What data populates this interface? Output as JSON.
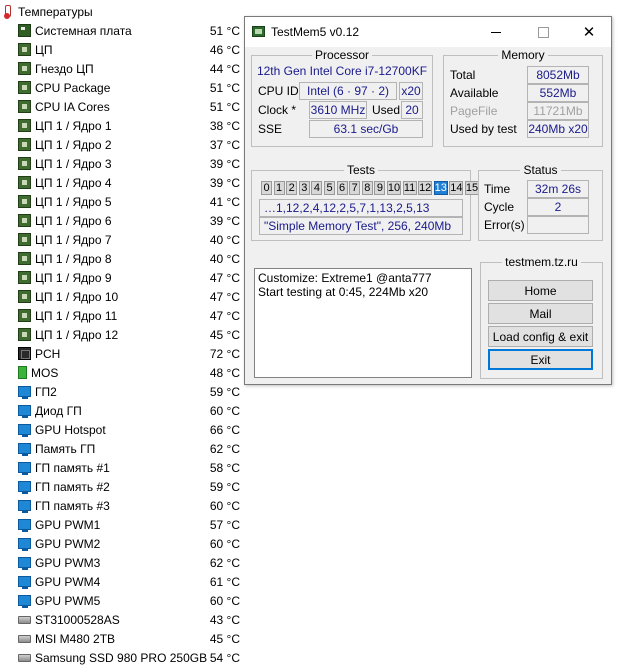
{
  "sensors": {
    "root_label": "Температуры",
    "items": [
      {
        "name": "Системная плата",
        "value": "51 °C",
        "icon": "motherboard-icon"
      },
      {
        "name": "ЦП",
        "value": "46 °C",
        "icon": "cpu-icon"
      },
      {
        "name": "Гнездо ЦП",
        "value": "44 °C",
        "icon": "cpu-icon"
      },
      {
        "name": "CPU Package",
        "value": "51 °C",
        "icon": "cpu-icon"
      },
      {
        "name": "CPU IA Cores",
        "value": "51 °C",
        "icon": "cpu-icon"
      },
      {
        "name": "ЦП 1 / Ядро 1",
        "value": "38 °C",
        "icon": "cpu-icon"
      },
      {
        "name": "ЦП 1 / Ядро 2",
        "value": "37 °C",
        "icon": "cpu-icon"
      },
      {
        "name": "ЦП 1 / Ядро 3",
        "value": "39 °C",
        "icon": "cpu-icon"
      },
      {
        "name": "ЦП 1 / Ядро 4",
        "value": "39 °C",
        "icon": "cpu-icon"
      },
      {
        "name": "ЦП 1 / Ядро 5",
        "value": "41 °C",
        "icon": "cpu-icon"
      },
      {
        "name": "ЦП 1 / Ядро 6",
        "value": "39 °C",
        "icon": "cpu-icon"
      },
      {
        "name": "ЦП 1 / Ядро 7",
        "value": "40 °C",
        "icon": "cpu-icon"
      },
      {
        "name": "ЦП 1 / Ядро 8",
        "value": "40 °C",
        "icon": "cpu-icon"
      },
      {
        "name": "ЦП 1 / Ядро 9",
        "value": "47 °C",
        "icon": "cpu-icon"
      },
      {
        "name": "ЦП 1 / Ядро 10",
        "value": "47 °C",
        "icon": "cpu-icon"
      },
      {
        "name": "ЦП 1 / Ядро 11",
        "value": "47 °C",
        "icon": "cpu-icon"
      },
      {
        "name": "ЦП 1 / Ядро 12",
        "value": "45 °C",
        "icon": "cpu-icon"
      },
      {
        "name": "PCH",
        "value": "72 °C",
        "icon": "chipset-icon"
      },
      {
        "name": "MOS",
        "value": "48 °C",
        "icon": "mos-icon"
      },
      {
        "name": "ГП2",
        "value": "59 °C",
        "icon": "gpu-icon"
      },
      {
        "name": "Диод ГП",
        "value": "60 °C",
        "icon": "gpu-icon"
      },
      {
        "name": "GPU Hotspot",
        "value": "66 °C",
        "icon": "gpu-icon"
      },
      {
        "name": "Память ГП",
        "value": "62 °C",
        "icon": "gpu-icon"
      },
      {
        "name": "ГП память #1",
        "value": "58 °C",
        "icon": "gpu-icon"
      },
      {
        "name": "ГП память #2",
        "value": "59 °C",
        "icon": "gpu-icon"
      },
      {
        "name": "ГП память #3",
        "value": "60 °C",
        "icon": "gpu-icon"
      },
      {
        "name": "GPU PWM1",
        "value": "57 °C",
        "icon": "gpu-icon"
      },
      {
        "name": "GPU PWM2",
        "value": "60 °C",
        "icon": "gpu-icon"
      },
      {
        "name": "GPU PWM3",
        "value": "62 °C",
        "icon": "gpu-icon"
      },
      {
        "name": "GPU PWM4",
        "value": "61 °C",
        "icon": "gpu-icon"
      },
      {
        "name": "GPU PWM5",
        "value": "60 °C",
        "icon": "gpu-icon"
      },
      {
        "name": "ST31000528AS",
        "value": "43 °C",
        "icon": "disk-icon"
      },
      {
        "name": "MSI M480 2TB",
        "value": "45 °C",
        "icon": "disk-icon"
      },
      {
        "name": "Samsung SSD 980 PRO 250GB",
        "value": "54 °C",
        "icon": "disk-icon"
      }
    ]
  },
  "window": {
    "title": "TestMem5 v0.12",
    "processor": {
      "group_title": "Processor",
      "name": "12th Gen Intel Core i7-12700KF",
      "cpu_id_label": "CPU ID",
      "cpu_id_value": "Intel  (6 · 97 · 2)",
      "cpu_id_threads": "x20",
      "clock_label": "Clock *",
      "clock_value": "3610 MHz",
      "used_label": "Used",
      "used_value": "20",
      "sse_label": "SSE",
      "sse_value": "63.1 sec/Gb"
    },
    "memory": {
      "group_title": "Memory",
      "total_label": "Total",
      "total_value": "8052Mb",
      "available_label": "Available",
      "available_value": "552Mb",
      "pagefile_label": "PageFile",
      "pagefile_value": "11721Mb",
      "usedby_label": "Used by test",
      "usedby_value": "240Mb x20"
    },
    "tests": {
      "group_title": "Tests",
      "cells": [
        "0",
        "1",
        "2",
        "3",
        "4",
        "5",
        "6",
        "7",
        "8",
        "9",
        "10",
        "11",
        "12",
        "13",
        "14",
        "15"
      ],
      "active_cell": "13",
      "sequence": "…1,12,2,4,12,2,5,7,1,13,2,5,13",
      "config": "\"Simple Memory Test\", 256, 240Mb"
    },
    "status": {
      "group_title": "Status",
      "time_label": "Time",
      "time_value": "32m 26s",
      "cycle_label": "Cycle",
      "cycle_value": "2",
      "errors_label": "Error(s)",
      "errors_value": ""
    },
    "log": {
      "line1": "Customize: Extreme1 @anta777",
      "line2": "Start testing at 0:45, 224Mb x20"
    },
    "side": {
      "site": "testmem.tz.ru",
      "home": "Home",
      "mail": "Mail",
      "load": "Load config & exit",
      "exit": "Exit"
    }
  }
}
